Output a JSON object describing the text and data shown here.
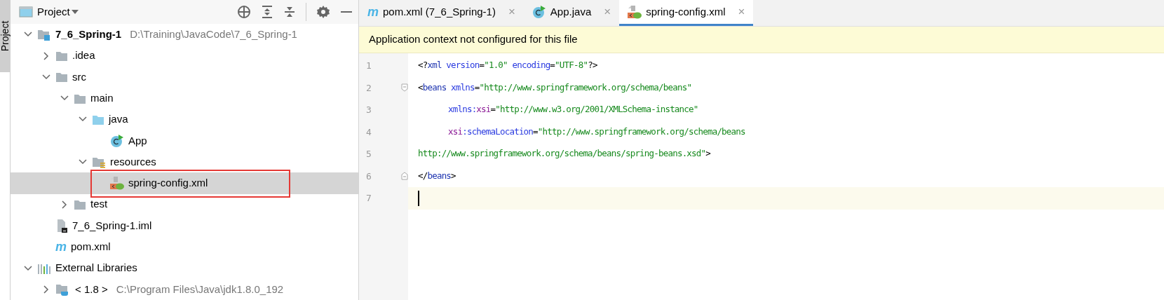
{
  "side_strip": {
    "label": "Project"
  },
  "project_panel": {
    "title": "Project",
    "tree": [
      {
        "label": "7_6_Spring-1",
        "path": "D:\\Training\\JavaCode\\7_6_Spring-1",
        "kind": "module",
        "expanded": true,
        "selected": false,
        "children": [
          {
            "label": ".idea",
            "kind": "folder",
            "expanded": false,
            "selected": false
          },
          {
            "label": "src",
            "kind": "folder",
            "expanded": true,
            "selected": false,
            "children": [
              {
                "label": "main",
                "kind": "folder",
                "expanded": true,
                "selected": false,
                "children": [
                  {
                    "label": "java",
                    "kind": "source-folder",
                    "expanded": true,
                    "selected": false,
                    "children": [
                      {
                        "label": "App",
                        "kind": "class",
                        "selected": false
                      }
                    ]
                  },
                  {
                    "label": "resources",
                    "kind": "resources-folder",
                    "expanded": true,
                    "selected": false,
                    "children": [
                      {
                        "label": "spring-config.xml",
                        "kind": "spring-xml",
                        "selected": true,
                        "highlighted": true
                      }
                    ]
                  }
                ]
              },
              {
                "label": "test",
                "kind": "folder",
                "expanded": false,
                "selected": false
              }
            ]
          },
          {
            "label": "7_6_Spring-1.iml",
            "kind": "iml",
            "selected": false
          },
          {
            "label": "pom.xml",
            "kind": "maven",
            "glyph": "m",
            "selected": false
          }
        ]
      },
      {
        "label": "External Libraries",
        "kind": "libraries",
        "expanded": true,
        "selected": false,
        "children": [
          {
            "label": "< 1.8 >",
            "path": "C:\\Program Files\\Java\\jdk1.8.0_192",
            "kind": "jdk",
            "expanded": false,
            "selected": false
          }
        ]
      }
    ]
  },
  "editor": {
    "tabs": [
      {
        "label": "pom.xml (7_6_Spring-1)",
        "kind": "maven",
        "glyph": "m",
        "close": "×",
        "selected": false
      },
      {
        "label": "App.java",
        "kind": "class",
        "close": "×",
        "selected": false
      },
      {
        "label": "spring-config.xml",
        "kind": "spring-xml",
        "close": "×",
        "selected": true
      }
    ],
    "banner": "Application context not configured for this file",
    "lines": [
      {
        "number": "1",
        "current": false,
        "indented": false,
        "fold_start": false,
        "fold_end": false,
        "tokens": [
          {
            "kind": "plain",
            "text": "<?"
          },
          {
            "kind": "tag",
            "text": "xml"
          },
          {
            "kind": "attr",
            "text": " version"
          },
          {
            "kind": "plain",
            "text": "="
          },
          {
            "kind": "value",
            "text": "\"1.0\""
          },
          {
            "kind": "attr",
            "text": " encoding"
          },
          {
            "kind": "plain",
            "text": "="
          },
          {
            "kind": "value",
            "text": "\"UTF-8\""
          },
          {
            "kind": "plain",
            "text": "?>"
          }
        ]
      },
      {
        "number": "2",
        "current": false,
        "indented": false,
        "fold_start": true,
        "fold_end": false,
        "tokens": [
          {
            "kind": "plain",
            "text": "<"
          },
          {
            "kind": "tag",
            "text": "beans"
          },
          {
            "kind": "attr",
            "text": " xmlns"
          },
          {
            "kind": "plain",
            "text": "="
          },
          {
            "kind": "value",
            "text": "\"http://www.springframework.org/schema/beans\""
          }
        ]
      },
      {
        "number": "3",
        "current": false,
        "indented": true,
        "fold_start": false,
        "fold_end": false,
        "tokens": [
          {
            "kind": "attr",
            "text": "xmlns:"
          },
          {
            "kind": "namespace",
            "text": "xsi"
          },
          {
            "kind": "plain",
            "text": "="
          },
          {
            "kind": "value",
            "text": "\"http://www.w3.org/2001/XMLSchema-instance\""
          }
        ]
      },
      {
        "number": "4",
        "current": false,
        "indented": true,
        "fold_start": false,
        "fold_end": false,
        "tokens": [
          {
            "kind": "namespace",
            "text": "xsi"
          },
          {
            "kind": "attr",
            "text": ":schemaLocation"
          },
          {
            "kind": "plain",
            "text": "="
          },
          {
            "kind": "value",
            "text": "\"http://www.springframework.org/schema/beans"
          }
        ]
      },
      {
        "number": "5",
        "current": false,
        "indented": false,
        "fold_start": false,
        "fold_end": false,
        "tokens": [
          {
            "kind": "value",
            "text": "http://www.springframework.org/schema/beans/spring-beans.xsd\""
          },
          {
            "kind": "plain",
            "text": ">"
          }
        ]
      },
      {
        "number": "6",
        "current": false,
        "indented": false,
        "fold_start": false,
        "fold_end": true,
        "tokens": [
          {
            "kind": "plain",
            "text": "</"
          },
          {
            "kind": "tag",
            "text": "beans"
          },
          {
            "kind": "plain",
            "text": ">"
          }
        ]
      },
      {
        "number": "7",
        "current": true,
        "indented": false,
        "fold_start": false,
        "fold_end": false
      }
    ]
  }
}
